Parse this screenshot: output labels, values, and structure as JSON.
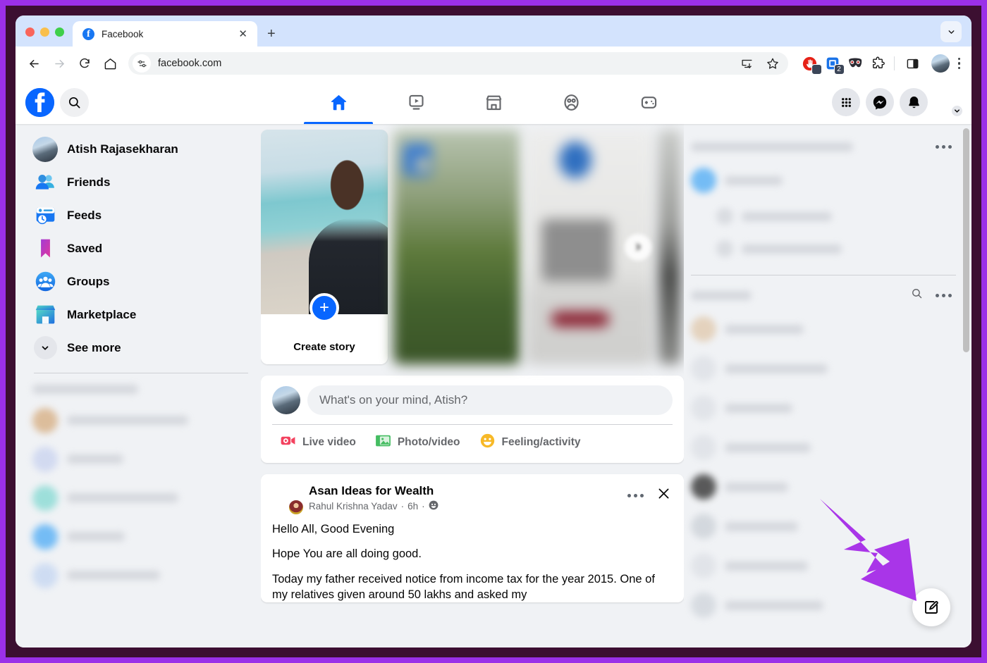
{
  "browser": {
    "traffic_lights": [
      "close",
      "minimize",
      "maximize"
    ],
    "tab": {
      "title": "Facebook",
      "favicon": "facebook-icon",
      "close_label": "✕"
    },
    "new_tab_label": "+",
    "tabstrip_chevron": "chevron-down-icon",
    "nav": {
      "back": "back-arrow-icon",
      "forward": "forward-arrow-icon",
      "reload": "reload-icon",
      "home": "home-icon"
    },
    "omnibox": {
      "site_settings_icon": "tune-icon",
      "url": "facebook.com",
      "install_icon": "install-app-icon",
      "bookmark_icon": "star-icon"
    },
    "extensions": [
      {
        "name": "adblock-icon",
        "badge": ""
      },
      {
        "name": "blue-extension-icon",
        "badge": "2"
      },
      {
        "name": "mask-extension-icon",
        "badge": ""
      },
      {
        "name": "puzzle-extensions-icon",
        "badge": ""
      }
    ],
    "side_panel_icon": "side-panel-icon",
    "profile_icon": "chrome-profile-avatar",
    "menu_icon": "kebab-menu-icon"
  },
  "facebook": {
    "header": {
      "logo": "facebook-logo",
      "search_icon": "search-icon",
      "nav_tabs": [
        {
          "name": "home",
          "icon": "home-icon",
          "active": true
        },
        {
          "name": "video",
          "icon": "video-icon",
          "active": false
        },
        {
          "name": "marketplace",
          "icon": "marketplace-icon",
          "active": false
        },
        {
          "name": "groups",
          "icon": "groups-icon",
          "active": false
        },
        {
          "name": "gaming",
          "icon": "gaming-icon",
          "active": false
        }
      ],
      "right_actions": [
        {
          "name": "menu-grid",
          "icon": "grid-icon"
        },
        {
          "name": "messenger",
          "icon": "messenger-icon"
        },
        {
          "name": "notifications",
          "icon": "bell-icon"
        }
      ],
      "profile": {
        "name": "account-avatar",
        "chevron": "chevron-down-icon"
      }
    },
    "sidebar": {
      "items": [
        {
          "label": "Atish Rajasekharan",
          "icon": "profile-avatar"
        },
        {
          "label": "Friends",
          "icon": "friends-icon"
        },
        {
          "label": "Feeds",
          "icon": "feeds-icon"
        },
        {
          "label": "Saved",
          "icon": "saved-bookmark-icon"
        },
        {
          "label": "Groups",
          "icon": "groups-icon"
        },
        {
          "label": "Marketplace",
          "icon": "marketplace-icon"
        },
        {
          "label": "See more",
          "icon": "chevron-down-icon"
        }
      ],
      "shortcuts_section_blurred": true
    },
    "stories": {
      "create_story_label": "Create story",
      "create_plus": "+",
      "next_arrow": "chevron-right-icon",
      "cards": [
        "create-story",
        "story-2-blurred",
        "story-3-blurred",
        "story-4-blurred"
      ]
    },
    "composer": {
      "placeholder": "What's on your mind, Atish?",
      "actions": [
        {
          "label": "Live video",
          "icon": "live-video-icon",
          "color": "#f3425f"
        },
        {
          "label": "Photo/video",
          "icon": "photo-video-icon",
          "color": "#45bd62"
        },
        {
          "label": "Feeling/activity",
          "icon": "feeling-activity-icon",
          "color": "#f7b928"
        }
      ]
    },
    "post": {
      "group_name": "Asan Ideas for Wealth",
      "author": "Rahul Krishna Yadav",
      "separator": "·",
      "time": "6h",
      "audience_icon": "group-audience-icon",
      "more_icon": "more-options-icon",
      "close_icon": "close-icon",
      "paragraphs": [
        "Hello All, Good Evening",
        "Hope You are all doing good.",
        "Today my father received notice from income tax for the year 2015. One of my relatives given around 50 lakhs and asked my"
      ]
    },
    "right_sidebar": {
      "blurred": true,
      "more_icon": "more-options-icon",
      "search_icon": "search-icon",
      "contacts_more_icon": "more-options-icon"
    },
    "fab": {
      "icon": "compose-edit-icon"
    },
    "scrollbar": "vertical-scrollbar"
  },
  "annotation": {
    "arrow": {
      "color": "#a935e8",
      "points_to": "compose-edit-fab"
    },
    "border_color": "#9b30e8"
  }
}
